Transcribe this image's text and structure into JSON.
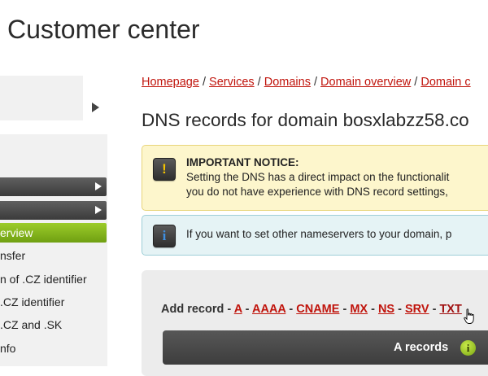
{
  "header": {
    "title": "Customer center"
  },
  "sidebar": {
    "active_item": "erview",
    "items": [
      {
        "label": "nsfer"
      },
      {
        "label": "n of .CZ identifier"
      },
      {
        "label": ".CZ identifier"
      },
      {
        "label": ".CZ and .SK"
      },
      {
        "label": "nfo"
      }
    ]
  },
  "breadcrumb": {
    "items": [
      "Homepage",
      "Services",
      "Domains",
      "Domain overview",
      "Domain c"
    ],
    "separator": " / "
  },
  "page": {
    "title": "DNS records for domain bosxlabzz58.co"
  },
  "notices": {
    "important": {
      "icon": "warning-icon",
      "heading": "IMPORTANT NOTICE:",
      "line1": "Setting the DNS has a direct impact on the functionalit",
      "line2": "you do not have experience with DNS record settings,"
    },
    "info": {
      "icon": "info-icon",
      "text": "If you want to set other nameservers to your domain, p"
    }
  },
  "add_record": {
    "label": "Add record",
    "types": [
      "A",
      "AAAA",
      "CNAME",
      "MX",
      "NS",
      "SRV",
      "TXT"
    ]
  },
  "records_section": {
    "title": "A records",
    "info_glyph": "i"
  },
  "colors": {
    "link": "#c0140c",
    "active_green": "#8cc21f",
    "dark_bar": "#474747",
    "notice_yellow": "#fdf6cc",
    "notice_blue": "#e5f3f5"
  }
}
